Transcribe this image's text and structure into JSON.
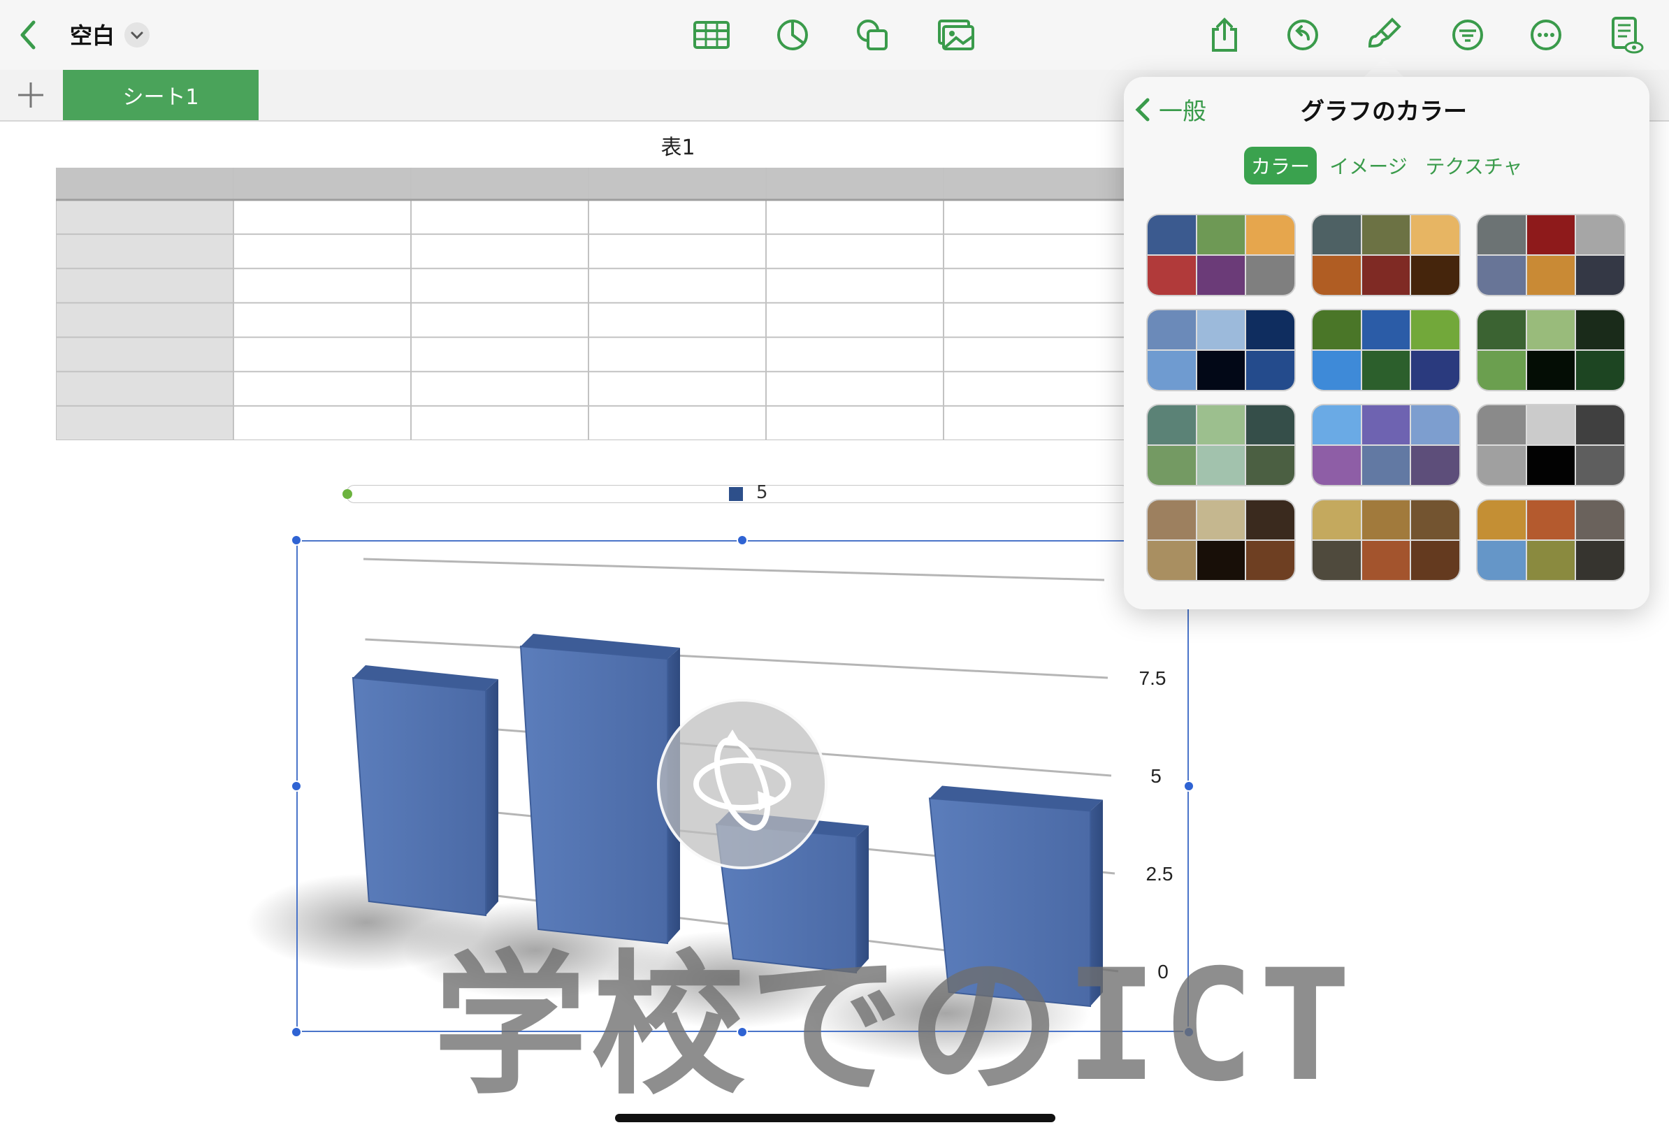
{
  "toolbar": {
    "doc_title": "空白",
    "icons": [
      "back-chevron-icon",
      "table-icon",
      "chart-icon",
      "shape-icon",
      "media-icon",
      "share-icon",
      "undo-icon",
      "format-brush-icon",
      "organize-icon",
      "more-icon",
      "reader-view-icon"
    ],
    "accent": "#3a9b4b"
  },
  "sheets": {
    "add_label": "+",
    "tabs": [
      {
        "label": "シート1",
        "active": true
      }
    ]
  },
  "table": {
    "title": "表1",
    "columns": 6,
    "rows": 7
  },
  "chart_data": {
    "type": "bar",
    "categories": [
      "",
      "",
      "",
      ""
    ],
    "series": [
      {
        "name": "5",
        "values": [
          8,
          10,
          5,
          7
        ],
        "color": "#4f70ab"
      }
    ],
    "yticks": [
      "0",
      "2.5",
      "5",
      "7.5"
    ],
    "ylim": [
      0,
      10
    ],
    "style": "3d"
  },
  "watermark": "学校でのICT",
  "popover": {
    "back_label": "一般",
    "title": "グラフのカラー",
    "segments": [
      {
        "label": "カラー",
        "selected": true
      },
      {
        "label": "イメージ",
        "selected": false
      },
      {
        "label": "テクスチャ",
        "selected": false
      }
    ],
    "palettes": [
      [
        "#3b5a8f",
        "#6e9955",
        "#e6a64d",
        "#b13a3a",
        "#6b3b78",
        "#7f7f7f"
      ],
      [
        "#4e6164",
        "#6c7244",
        "#e7b563",
        "#b05d23",
        "#7f2a24",
        "#45250c"
      ],
      [
        "#6c7374",
        "#8e1a1b",
        "#a6a6a6",
        "#687597",
        "#c98a35",
        "#343845"
      ],
      [
        "#6b8ab9",
        "#9cbadb",
        "#0f2d5f",
        "#6f9bd0",
        "#020817",
        "#244b8c"
      ],
      [
        "#4a7628",
        "#2b5ca7",
        "#72a83a",
        "#3e8ad8",
        "#2c5f2c",
        "#2a3a7e"
      ],
      [
        "#3b6332",
        "#99bb7b",
        "#1a2b1a",
        "#6b9f4f",
        "#040d05",
        "#1d4522"
      ],
      [
        "#5b8276",
        "#9cbf8e",
        "#354e49",
        "#749a63",
        "#a2c2ad",
        "#4b5f42"
      ],
      [
        "#6aaae5",
        "#6e63b1",
        "#7d9ecf",
        "#8e5ea6",
        "#6279a3",
        "#5d4e7a"
      ],
      [
        "#8a8a8a",
        "#cbcbcb",
        "#404040",
        "#a0a0a0",
        "#020202",
        "#5e5e5e"
      ],
      [
        "#9d805f",
        "#c5b78f",
        "#3a2a1e",
        "#a98f61",
        "#180f08",
        "#6e3f22"
      ],
      [
        "#c4a95e",
        "#a17a3c",
        "#735430",
        "#4f4a3d",
        "#a3542d",
        "#643a1f"
      ],
      [
        "#c48f34",
        "#b45a2e",
        "#6a625c",
        "#6596c8",
        "#8a8a3f",
        "#36342f"
      ]
    ]
  }
}
